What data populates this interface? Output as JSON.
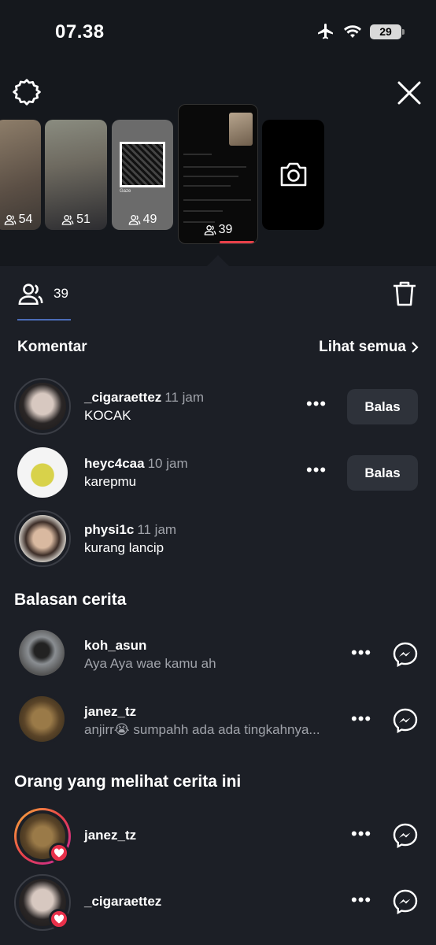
{
  "status_bar": {
    "time": "07.38",
    "battery": "29"
  },
  "story_thumbs": [
    {
      "count": "54"
    },
    {
      "count": "51"
    },
    {
      "count": "49",
      "title": "Gaze"
    },
    {
      "count": "39"
    }
  ],
  "viewers_tab": {
    "count": "39"
  },
  "comments": {
    "title": "Komentar",
    "see_all": "Lihat semua",
    "reply_label": "Balas",
    "items": [
      {
        "username": "_cigaraettez",
        "time": "11 jam",
        "text": "KOCAK"
      },
      {
        "username": "heyc4caa",
        "time": "10 jam",
        "text": "karepmu"
      },
      {
        "username": "physi1c",
        "time": "11 jam",
        "text": "kurang lancip"
      }
    ]
  },
  "story_replies": {
    "title": "Balasan cerita",
    "items": [
      {
        "username": "koh_asun",
        "text": "Aya Aya wae kamu ah"
      },
      {
        "username": "janez_tz",
        "text": "anjirr😭 sumpahh ada ada tingkahnya..."
      }
    ]
  },
  "viewers": {
    "title": "Orang yang melihat cerita ini",
    "items": [
      {
        "username": "janez_tz"
      },
      {
        "username": "_cigaraettez"
      }
    ]
  },
  "colors": {
    "background": "#1c1f26",
    "top": "#15181d",
    "heart": "#e8304a",
    "button": "#2e323a"
  }
}
